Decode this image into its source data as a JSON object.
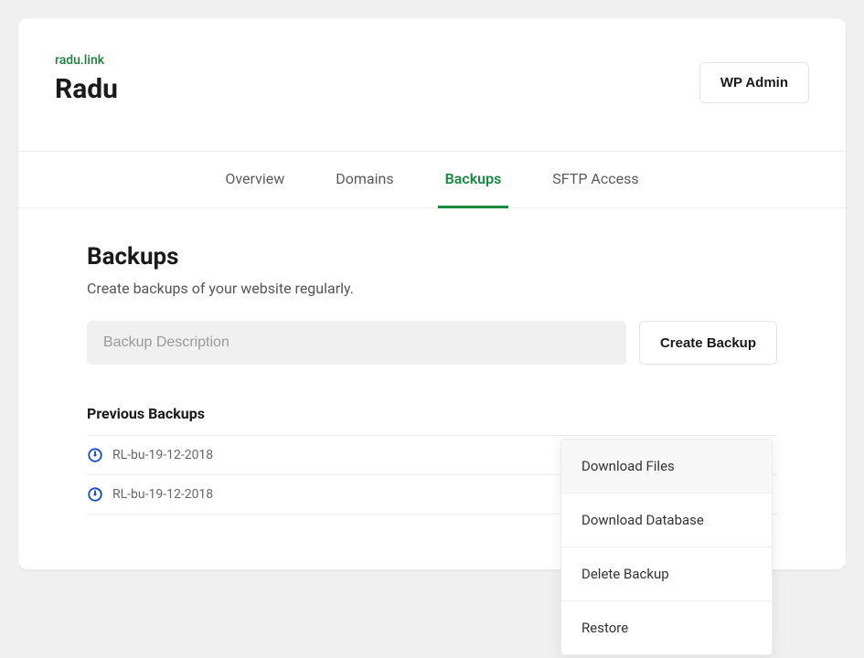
{
  "header": {
    "domain": "radu.link",
    "site_title": "Radu",
    "wp_admin_label": "WP Admin"
  },
  "tabs": {
    "overview": "Overview",
    "domains": "Domains",
    "backups": "Backups",
    "sftp": "SFTP Access"
  },
  "backups": {
    "title": "Backups",
    "description": "Create backups of your website regularly.",
    "input_placeholder": "Backup Description",
    "create_label": "Create Backup",
    "previous_title": "Previous Backups",
    "items": [
      {
        "name": "RL-bu-19-12-2018"
      },
      {
        "name": "RL-bu-19-12-2018"
      }
    ]
  },
  "menu": {
    "download_files": "Download Files",
    "download_db": "Download Database",
    "delete": "Delete Backup",
    "restore": "Restore"
  }
}
